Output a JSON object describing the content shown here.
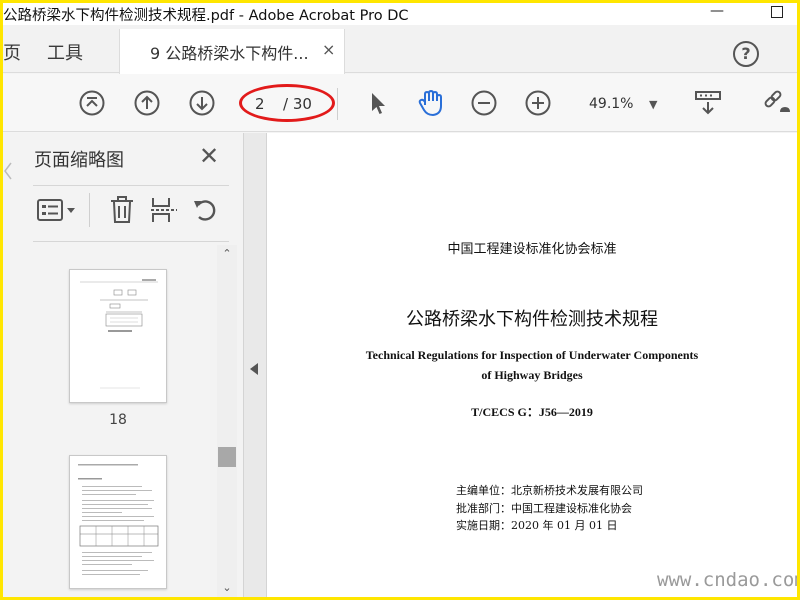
{
  "window": {
    "title": "公路桥梁水下构件检测技术规程.pdf - Adobe Acrobat Pro DC",
    "minimize_glyph": "—"
  },
  "tabs": {
    "home_partial": "页",
    "tools": "工具",
    "document": "9 公路桥梁水下构件...",
    "close_glyph": "×",
    "help_glyph": "?"
  },
  "toolbar": {
    "page_current": "2",
    "page_total": "/ 30",
    "zoom": "49.1%",
    "icons": [
      "go-first-page-icon",
      "previous-page-icon",
      "next-page-icon",
      "select-arrow-icon",
      "hand-tool-icon",
      "zoom-out-icon",
      "zoom-in-icon",
      "scroll-mode-icon",
      "share-link-icon"
    ],
    "annotation_color": "#e21a1a",
    "accent_color": "#2a6fd8"
  },
  "thumbnails_panel": {
    "title": "页面缩略图",
    "close_glyph": "✕",
    "icons": [
      "thumbnail-options-icon",
      "delete-page-icon",
      "extract-page-icon",
      "rotate-page-icon"
    ],
    "thumbnails": [
      {
        "label": "18"
      },
      {
        "label": ""
      }
    ]
  },
  "document": {
    "org": "中国工程建设标准化协会标准",
    "title_cn": "公路桥梁水下构件检测技术规程",
    "title_en_line1": "Technical Regulations for Inspection of Underwater Components",
    "title_en_line2": "of Highway Bridges",
    "code": "T/CECS G：J56—2019",
    "meta": [
      "主编单位：北京新桥技术发展有限公司",
      "批准部门：中国工程建设标准化协会",
      "实施日期：2020 年 01 月 01 日"
    ]
  },
  "watermark": "www.cndao.com"
}
